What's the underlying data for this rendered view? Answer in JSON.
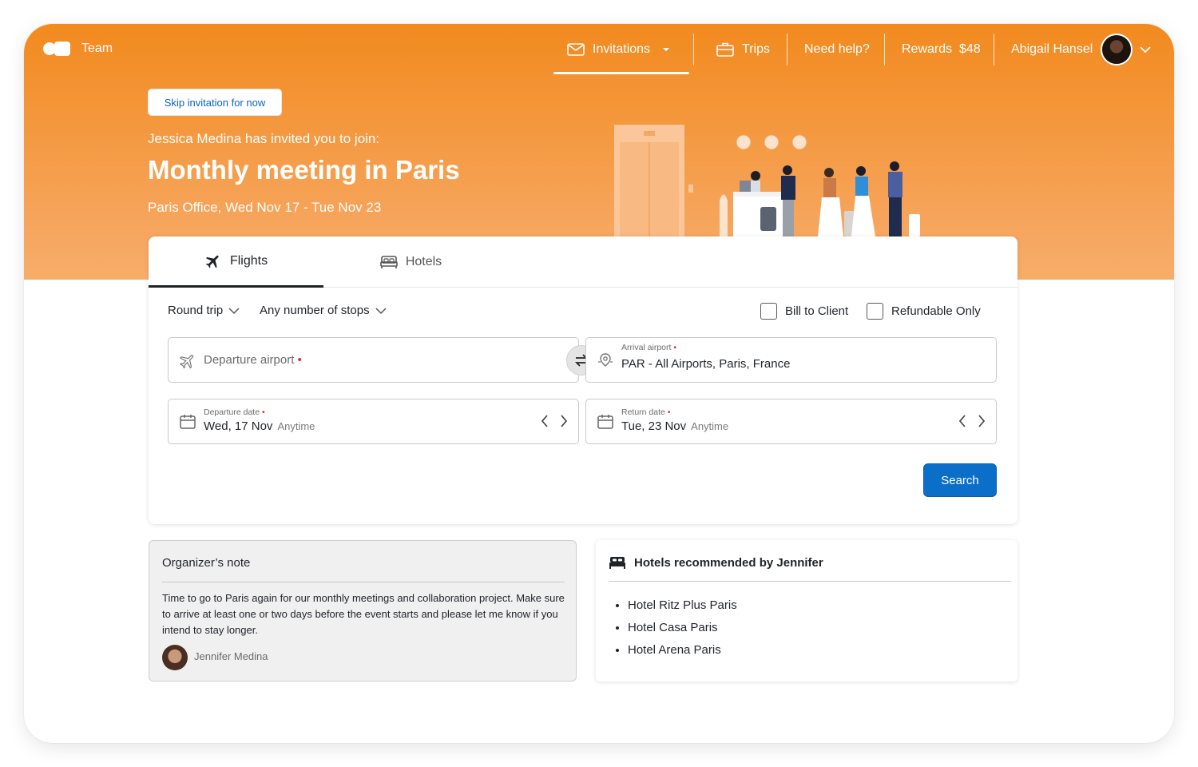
{
  "nav": {
    "brand": "Team",
    "invitations": "Invitations",
    "trips": "Trips",
    "help": "Need help?",
    "rewards_label": "Rewards",
    "rewards_value": "$48",
    "user_name": "Abigail Hansel"
  },
  "hero": {
    "skip_button": "Skip invitation for now",
    "invite_line": "Jessica Medina has invited you to join:",
    "event_title": "Monthly meeting in Paris",
    "event_meta": "Paris Office, Wed Nov 17 - Tue Nov 23"
  },
  "search": {
    "tabs": [
      {
        "label": "Flights",
        "active": true
      },
      {
        "label": "Hotels",
        "active": false
      }
    ],
    "trip_type": "Round trip",
    "stops": "Any number of stops",
    "bill_to_client": "Bill to Client",
    "refundable_only": "Refundable Only",
    "departure_airport_placeholder": "Departure airport",
    "arrival_airport_label": "Arrival airport",
    "arrival_airport_value": "PAR - All Airports, Paris, France",
    "departure_date_label": "Departure date",
    "departure_date_value": "Wed, 17 Nov",
    "return_date_label": "Return date",
    "return_date_value": "Tue, 23 Nov",
    "time_any": "Anytime",
    "required_mark": "•",
    "search_button": "Search"
  },
  "organizer_note": {
    "title": "Organizer’s note",
    "body": "Time to go to Paris again for our monthly meetings and collaboration project. Make sure to arrive at least one or two days before the event starts and please let me know if you intend to stay longer.",
    "author": "Jennifer Medina"
  },
  "hotels_recommended": {
    "title": "Hotels recommended by Jennifer",
    "items": [
      "Hotel Ritz Plus Paris",
      "Hotel Casa Paris",
      "Hotel Arena Paris"
    ]
  },
  "colors": {
    "brand_orange": "#f28a1e",
    "primary_blue": "#0b6fc9",
    "required_red": "#e0282e"
  }
}
